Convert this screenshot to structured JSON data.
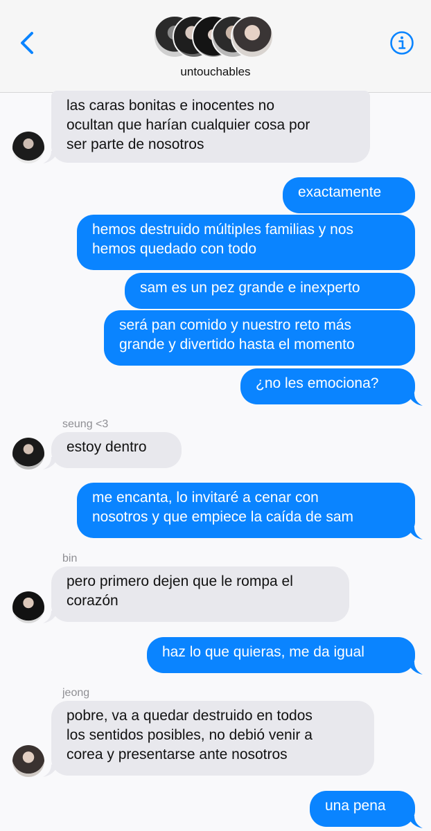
{
  "header": {
    "group_name": "untouchables",
    "back_icon": "chevron-left-icon",
    "info_icon": "info-icon",
    "accent": "#0a84ff"
  },
  "messages": [
    {
      "dir": "in",
      "sender": "",
      "lines": [
        "las caras bonitas e inocentes no",
        "ocultan que harían cualquier cosa por",
        "ser parte de nosotros"
      ]
    },
    {
      "dir": "out",
      "lines": [
        "exactamente"
      ]
    },
    {
      "dir": "out",
      "lines": [
        "hemos destruido múltiples familias y nos",
        "hemos quedado con todo"
      ]
    },
    {
      "dir": "out",
      "lines": [
        "sam es un pez grande e inexperto"
      ]
    },
    {
      "dir": "out",
      "lines": [
        "será pan comido y nuestro reto más",
        "grande y divertido hasta el momento"
      ]
    },
    {
      "dir": "out",
      "lines": [
        "¿no les emociona?"
      ]
    },
    {
      "dir": "in",
      "sender": "seung <3",
      "lines": [
        "estoy dentro"
      ]
    },
    {
      "dir": "out",
      "lines": [
        "me encanta, lo invitaré a cenar con",
        "nosotros y que empiece la caída de sam"
      ]
    },
    {
      "dir": "in",
      "sender": "bin",
      "lines": [
        "pero primero dejen que le rompa el",
        "corazón"
      ]
    },
    {
      "dir": "out",
      "lines": [
        "haz lo que quieras, me da igual"
      ]
    },
    {
      "dir": "in",
      "sender": "jeong",
      "lines": [
        "pobre, va a quedar destruido en todos",
        "los sentidos posibles, no debió venir a",
        "corea y presentarse ante nosotros"
      ]
    },
    {
      "dir": "out",
      "lines": [
        "una pena"
      ]
    }
  ]
}
